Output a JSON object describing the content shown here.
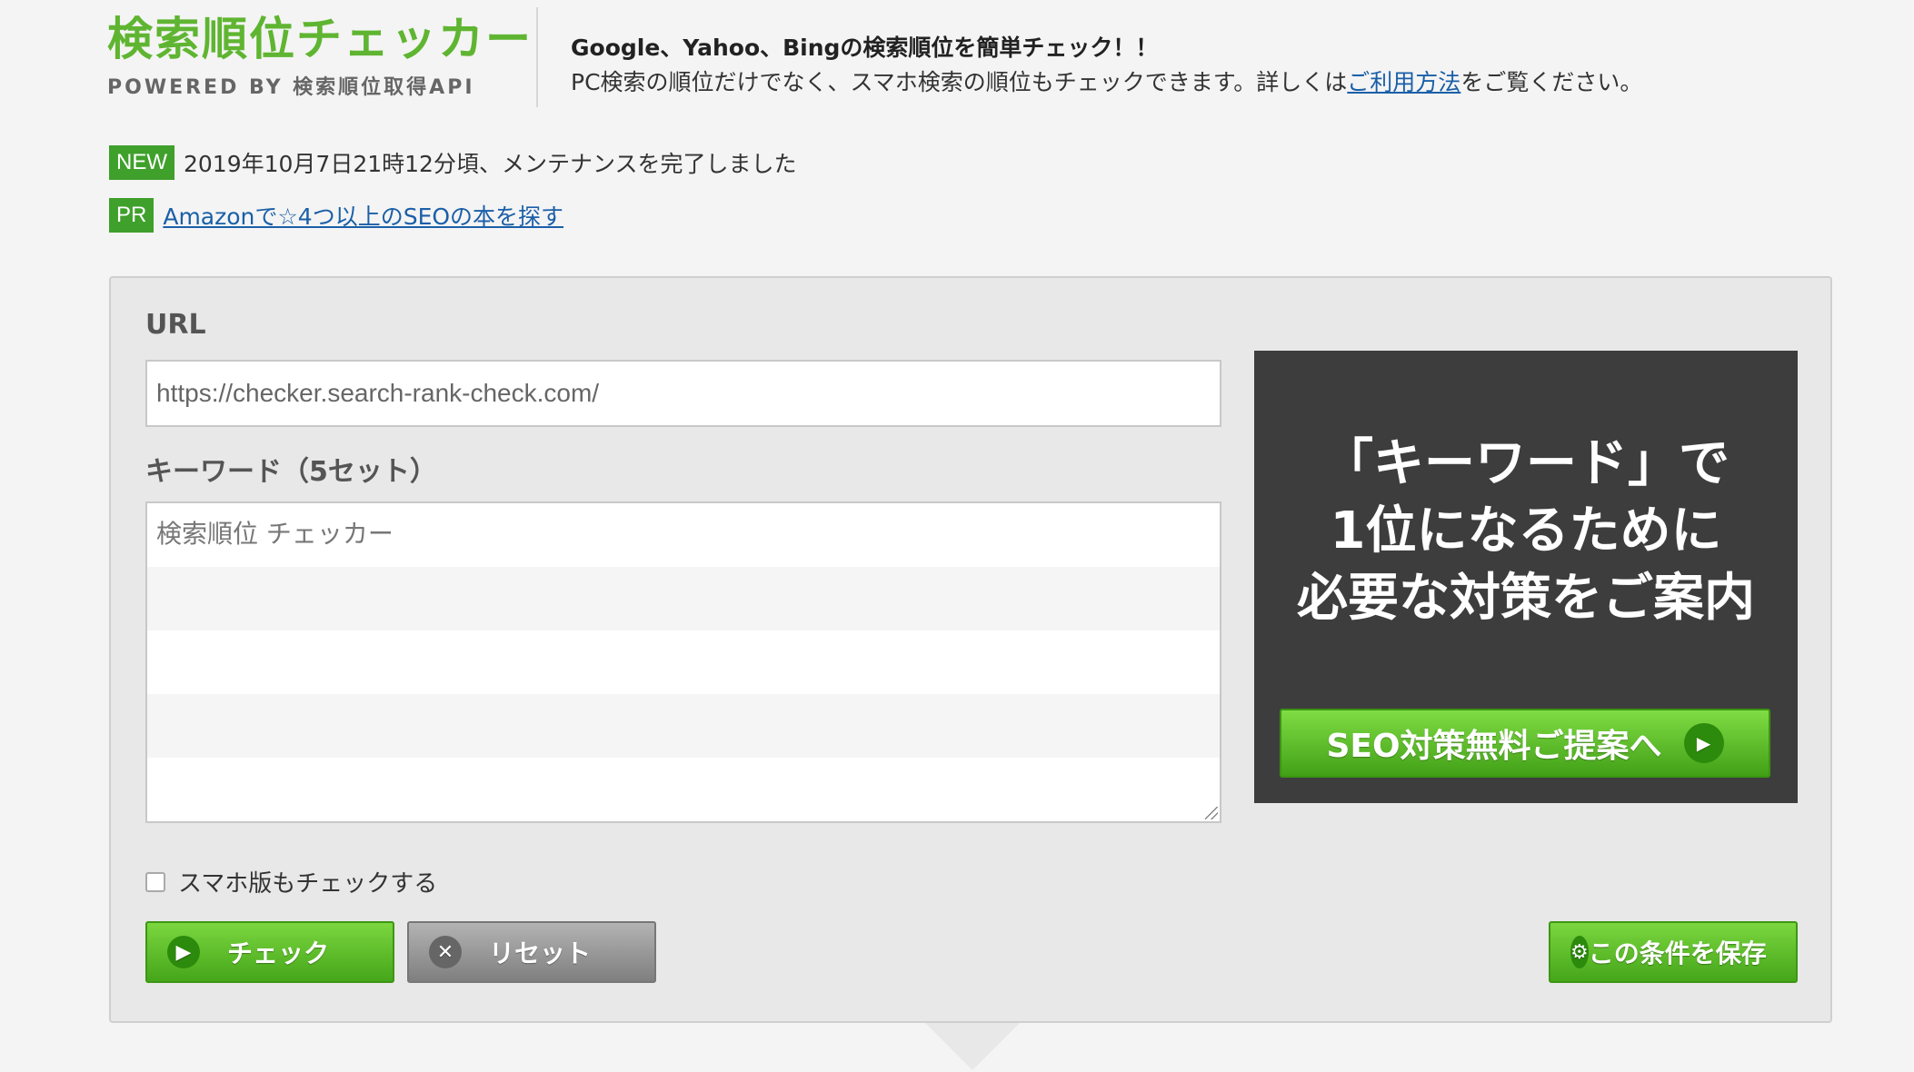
{
  "header": {
    "logo_title": "検索順位チェッカー",
    "logo_sub": "POWERED BY 検索順位取得API",
    "lead": "Google、Yahoo、Bingの検索順位を簡単チェック！！",
    "desc_before": "PC検索の順位だけでなく、スマホ検索の順位もチェックできます。詳しくは",
    "desc_link": "ご利用方法",
    "desc_after": "をご覧ください。"
  },
  "notices": [
    {
      "tag": "NEW",
      "text": "2019年10月7日21時12分頃、メンテナンスを完了しました"
    },
    {
      "tag": "PR",
      "text": "Amazonで☆4つ以上のSEOの本を探す"
    }
  ],
  "form": {
    "url_label": "URL",
    "url_value": "https://checker.search-rank-check.com/",
    "keyword_label": "キーワード（5セット）",
    "keywords": [
      "検索順位 チェッカー",
      "",
      "",
      "",
      ""
    ],
    "sp_check_label": "スマホ版もチェックする",
    "check_button": "チェック",
    "reset_button": "リセット",
    "save_button": "この条件を保存"
  },
  "ad": {
    "line1": "「キーワード」で",
    "line2": "1位になるために",
    "line3": "必要な対策をご案内",
    "button": "SEO対策無料ご提案へ"
  },
  "colors": {
    "brand_green": "#5fb531",
    "tag_green": "#3fa02b",
    "link_blue": "#1a5fa8"
  }
}
